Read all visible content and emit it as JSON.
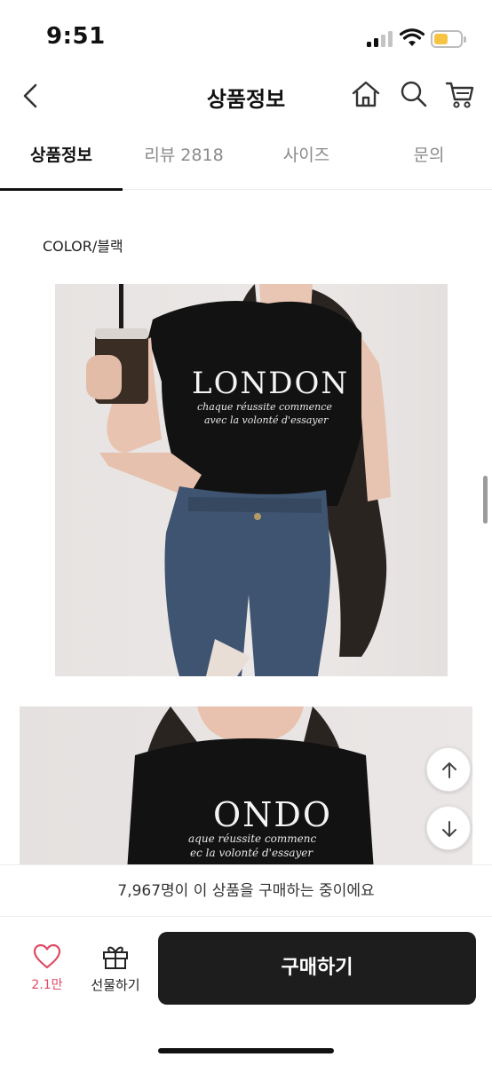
{
  "status_bar": {
    "time": "9:51"
  },
  "header": {
    "title": "상품정보",
    "icons": [
      "back-icon",
      "home-icon",
      "search-icon",
      "cart-icon"
    ]
  },
  "tabs": [
    {
      "label": "상품정보",
      "active": true
    },
    {
      "label": "리뷰 2818",
      "active": false
    },
    {
      "label": "사이즈",
      "active": false
    },
    {
      "label": "문의",
      "active": false
    }
  ],
  "content": {
    "color_label": "COLOR/블랙",
    "photo1": {
      "print_title": "LONDON",
      "print_line1": "chaque réussite commence",
      "print_line2": "avec la volonté d'essayer"
    },
    "photo2": {
      "print_title": "ONDO",
      "print_line1": "aque réussite commenc",
      "print_line2": "ec la volonté d'essayer"
    }
  },
  "scroll_buttons": [
    "arrow-up-icon",
    "arrow-down-icon"
  ],
  "notice": {
    "text": "7,967명이 이 상품을 구매하는 중이에요"
  },
  "bottom_bar": {
    "like_count": "2.1만",
    "gift_label": "선물하기",
    "buy_label": "구매하기"
  },
  "colors": {
    "like_accent": "#e04a63",
    "buy_button_bg": "#1d1d1d",
    "battery": "#f6c343"
  }
}
